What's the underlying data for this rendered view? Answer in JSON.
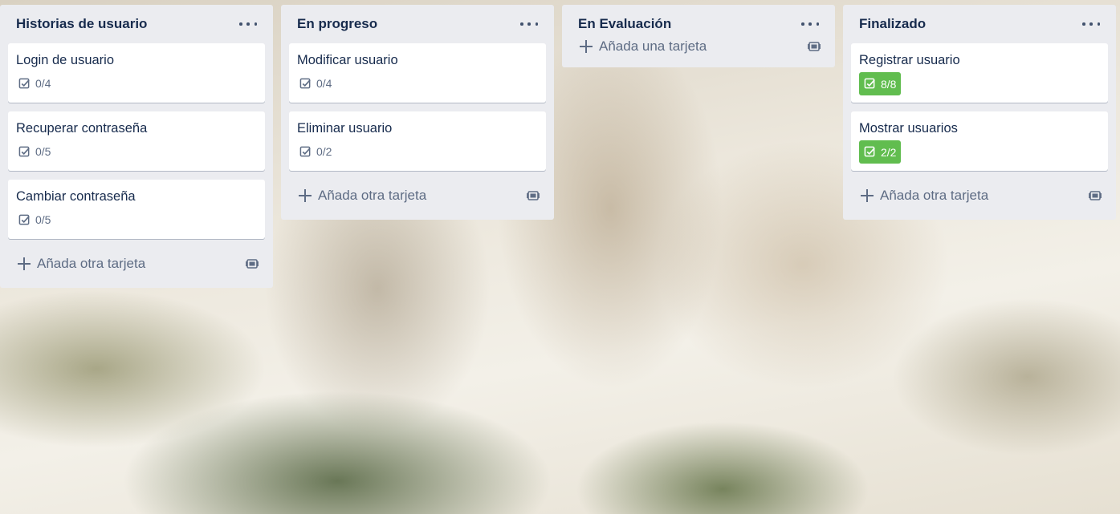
{
  "board": {
    "lists": [
      {
        "title": "Historias de usuario",
        "cards": [
          {
            "title": "Login de usuario",
            "checklist": "0/4",
            "complete": false
          },
          {
            "title": "Recuperar contraseña",
            "checklist": "0/5",
            "complete": false
          },
          {
            "title": "Cambiar contraseña",
            "checklist": "0/5",
            "complete": false
          }
        ],
        "add_label": "Añada otra tarjeta"
      },
      {
        "title": "En progreso",
        "cards": [
          {
            "title": "Modificar usuario",
            "checklist": "0/4",
            "complete": false
          },
          {
            "title": "Eliminar usuario",
            "checklist": "0/2",
            "complete": false
          }
        ],
        "add_label": "Añada otra tarjeta"
      },
      {
        "title": "En Evaluación",
        "cards": [],
        "add_label": "Añada una tarjeta"
      },
      {
        "title": "Finalizado",
        "cards": [
          {
            "title": "Registrar usuario",
            "checklist": "8/8",
            "complete": true
          },
          {
            "title": "Mostrar usuarios",
            "checklist": "2/2",
            "complete": true
          }
        ],
        "add_label": "Añada otra tarjeta"
      }
    ]
  },
  "colors": {
    "list_bg": "#ebecf0",
    "card_bg": "#ffffff",
    "text": "#172b4d",
    "muted": "#5e6c84",
    "complete_badge": "#61bd4f"
  },
  "icons": {
    "list_menu": "ellipsis-icon",
    "checklist": "checkbox-icon",
    "add": "plus-icon",
    "template": "card-template-icon"
  }
}
